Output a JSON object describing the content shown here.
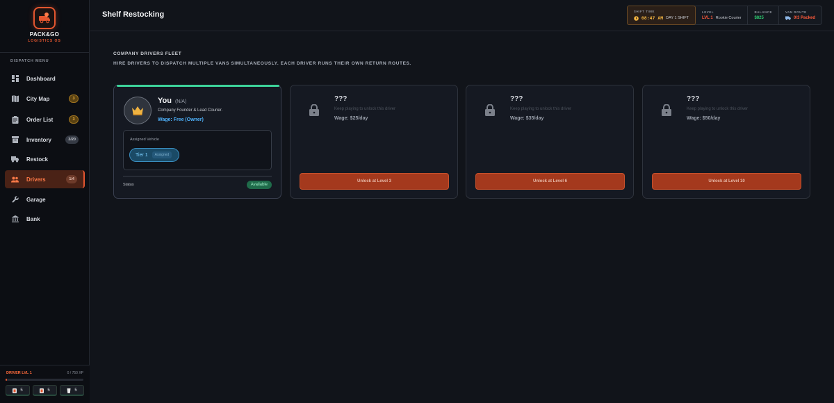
{
  "brand": {
    "name": "PACK&GO",
    "sub": "LOGISTICS OS"
  },
  "sidebar": {
    "menu_title": "DISPATCH MENU",
    "items": [
      {
        "label": "Dashboard",
        "icon": "dashboard-icon",
        "badge": ""
      },
      {
        "label": "City Map",
        "icon": "map-icon",
        "badge": "3"
      },
      {
        "label": "Order List",
        "icon": "clipboard-icon",
        "badge": "3"
      },
      {
        "label": "Inventory",
        "icon": "box-icon",
        "badge": "3/20"
      },
      {
        "label": "Restock",
        "icon": "truck-icon",
        "badge": ""
      },
      {
        "label": "Drivers",
        "icon": "users-icon",
        "badge": "1/4"
      },
      {
        "label": "Garage",
        "icon": "wrench-icon",
        "badge": ""
      },
      {
        "label": "Bank",
        "icon": "bank-icon",
        "badge": ""
      }
    ],
    "active_index": 5
  },
  "footer": {
    "level_label": "DRIVER LVL 1",
    "xp_text": "0 / 750 XP",
    "xp_progress": 0,
    "stock": [
      "5",
      "5",
      "5"
    ]
  },
  "header": {
    "title": "Shelf Restocking",
    "shift_label": "SHIFT TIME",
    "shift_time": "08:47 AM",
    "shift_day": "DAY 1 SHIFT",
    "level_label": "LEVEL",
    "level_value": "LVL 1",
    "level_rank": "Rookie Courier",
    "balance_label": "BALANCE",
    "balance_value": "$825",
    "van_label": "VAN ROUTE",
    "van_value": "0/3 Packed"
  },
  "main": {
    "section_title": "COMPANY DRIVERS FLEET",
    "section_desc": "HIRE DRIVERS TO DISPATCH MULTIPLE VANS SIMULTANEOUSLY. EACH DRIVER RUNS THEIR OWN RETURN ROUTES."
  },
  "owner_card": {
    "name": "You",
    "tag": "(N/A)",
    "description": "Company Founder & Lead Courier.",
    "wage": "Wage: Free (Owner)",
    "vehicle_label": "Assigned Vehicle",
    "vehicle_tier": "Tier 1",
    "vehicle_status": "Assigned",
    "status_label": "Status",
    "status_value": "Available"
  },
  "locked_cards": [
    {
      "name": "???",
      "hint": "Keep playing to unlock this driver",
      "wage": "Wage: $25/day",
      "button": "Unlock at Level 3"
    },
    {
      "name": "???",
      "hint": "Keep playing to unlock this driver",
      "wage": "Wage: $35/day",
      "button": "Unlock at Level 6"
    },
    {
      "name": "???",
      "hint": "Keep playing to unlock this driver",
      "wage": "Wage: $50/day",
      "button": "Unlock at Level 10"
    }
  ],
  "colors": {
    "accent": "#e3562f",
    "success": "#3dd39a",
    "link": "#4fb4ff"
  }
}
